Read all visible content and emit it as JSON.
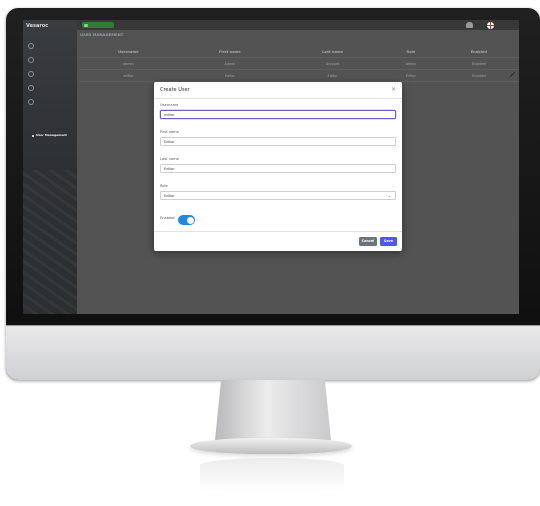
{
  "app": {
    "brand": "Vesaroc",
    "topbar_badge": "",
    "user_line1": "",
    "user_line2": ""
  },
  "sidebar": {
    "items": [
      {
        "label": ""
      },
      {
        "label": ""
      },
      {
        "label": ""
      },
      {
        "label": ""
      },
      {
        "label": ""
      }
    ],
    "sub_items": [
      {
        "label": ""
      },
      {
        "label": ""
      },
      {
        "label": ""
      },
      {
        "label": ""
      },
      {
        "label": ""
      },
      {
        "label": "User Management"
      }
    ]
  },
  "page": {
    "title": "USER MANAGEMENT"
  },
  "table": {
    "columns": [
      "Username",
      "First name",
      "Last name",
      "Role",
      "Enabled"
    ],
    "rows": [
      [
        "admin",
        "Admin",
        "Account",
        "admin",
        "Enabled"
      ],
      [
        "editor",
        "Editor",
        "Editor",
        "Editor",
        "Enabled"
      ]
    ]
  },
  "dialog": {
    "title": "Create User",
    "close": "×",
    "fields": [
      {
        "label": "Username",
        "value": "editor"
      },
      {
        "label": "First name",
        "value": "Editor"
      },
      {
        "label": "Last name",
        "value": "Editor"
      },
      {
        "label": "Role",
        "value": "Editor"
      }
    ],
    "enabled_label": "Enabled",
    "enabled_on": true,
    "cancel_label": "Cancel",
    "save_label": "Save"
  },
  "colors": {
    "accent": "#4e5ae6",
    "toggle": "#1e88e5",
    "badge": "#2e7d32"
  }
}
